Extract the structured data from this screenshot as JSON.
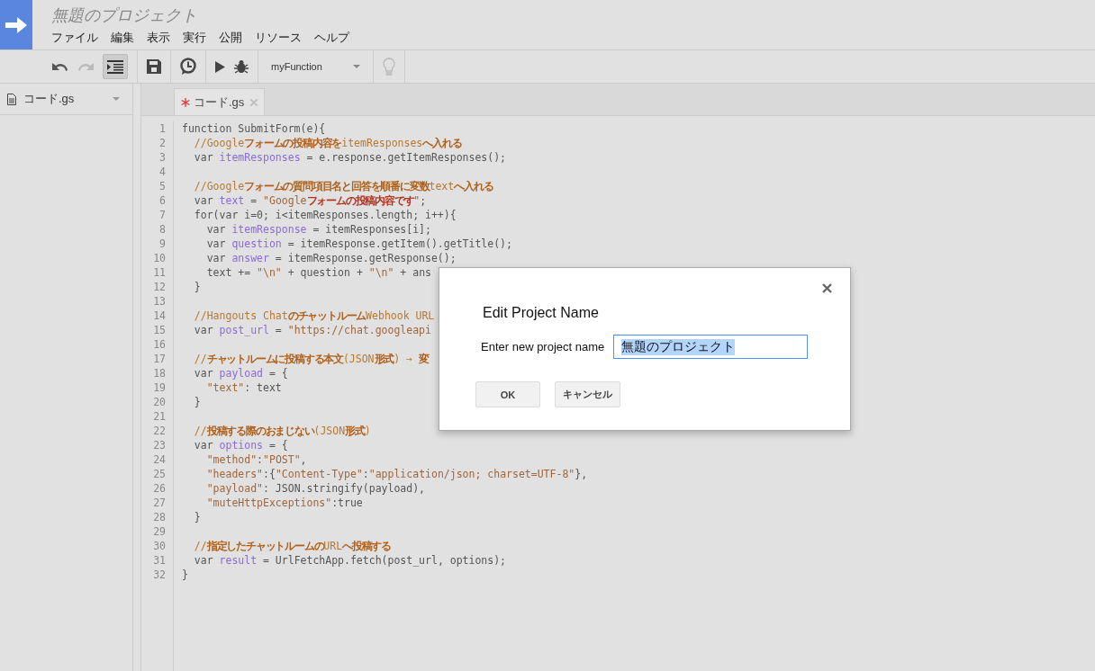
{
  "header": {
    "title": "無題のプロジェクト",
    "menu": [
      "ファイル",
      "編集",
      "表示",
      "実行",
      "公開",
      "リソース",
      "ヘルプ"
    ]
  },
  "toolbar": {
    "undo_disabled": false,
    "redo_disabled": true,
    "indent_on": true,
    "function_select": "myFunction",
    "hint_disabled": true
  },
  "sidebar": {
    "files": [
      {
        "name": "コード.gs"
      }
    ]
  },
  "tabs": [
    {
      "label": "コード.gs",
      "selected": true,
      "modified": true
    }
  ],
  "code": [
    {
      "number": "1",
      "tokens": [
        {
          "text": "function SubmitForm(e){",
          "kind": "plain"
        }
      ]
    },
    {
      "number": "2",
      "tokens": [
        {
          "text": "  //Google",
          "kind": "comment"
        },
        {
          "text": "フォームの投稿内容を",
          "kind": "comment-jp"
        },
        {
          "text": "itemResponses",
          "kind": "comment"
        },
        {
          "text": "へ入れる",
          "kind": "comment-jp"
        }
      ]
    },
    {
      "number": "3",
      "tokens": [
        {
          "text": "  var ",
          "kind": "plain"
        },
        {
          "text": "itemResponses",
          "kind": "def"
        },
        {
          "text": " = e.response.getItemResponses();",
          "kind": "plain"
        }
      ]
    },
    {
      "number": "4"
    },
    {
      "number": "5",
      "tokens": [
        {
          "text": "  //Google",
          "kind": "comment"
        },
        {
          "text": "フォームの質問項目名と回答を順番に変数",
          "kind": "comment-jp"
        },
        {
          "text": "text",
          "kind": "comment"
        },
        {
          "text": "へ入れる",
          "kind": "comment-jp"
        }
      ]
    },
    {
      "number": "6",
      "tokens": [
        {
          "text": "  var ",
          "kind": "plain"
        },
        {
          "text": "text",
          "kind": "def"
        },
        {
          "text": " = ",
          "kind": "plain"
        },
        {
          "text": "\"Google",
          "kind": "string"
        },
        {
          "text": "フォームの投稿内容です",
          "kind": "string-jp"
        },
        {
          "text": "\"",
          "kind": "string"
        },
        {
          "text": ";",
          "kind": "plain"
        }
      ]
    },
    {
      "number": "7",
      "tokens": [
        {
          "text": "  for(var i=0; i<itemResponses.length; i++){",
          "kind": "plain"
        }
      ]
    },
    {
      "number": "8",
      "tokens": [
        {
          "text": "    var ",
          "kind": "plain"
        },
        {
          "text": "itemResponse",
          "kind": "def"
        },
        {
          "text": " = itemResponses[i];",
          "kind": "plain"
        }
      ]
    },
    {
      "number": "9",
      "tokens": [
        {
          "text": "    var ",
          "kind": "plain"
        },
        {
          "text": "question",
          "kind": "def"
        },
        {
          "text": " = itemResponse.getItem().getTitle();",
          "kind": "plain"
        }
      ]
    },
    {
      "number": "10",
      "tokens": [
        {
          "text": "    var ",
          "kind": "plain"
        },
        {
          "text": "answer",
          "kind": "def"
        },
        {
          "text": " = itemResponse.getResponse();",
          "kind": "plain"
        }
      ]
    },
    {
      "number": "11",
      "tokens": [
        {
          "text": "    text += ",
          "kind": "plain"
        },
        {
          "text": "\"\\n\"",
          "kind": "string"
        },
        {
          "text": " + question + ",
          "kind": "plain"
        },
        {
          "text": "\"\\n\"",
          "kind": "string"
        },
        {
          "text": " + ans",
          "kind": "plain"
        }
      ]
    },
    {
      "number": "12",
      "tokens": [
        {
          "text": "  }",
          "kind": "plain"
        }
      ]
    },
    {
      "number": "13"
    },
    {
      "number": "14",
      "tokens": [
        {
          "text": "  //Hangouts Chat",
          "kind": "comment"
        },
        {
          "text": "のチャットルーム",
          "kind": "comment-jp"
        },
        {
          "text": "Webhook URL",
          "kind": "comment"
        }
      ]
    },
    {
      "number": "15",
      "tokens": [
        {
          "text": "  var ",
          "kind": "plain"
        },
        {
          "text": "post_url",
          "kind": "def"
        },
        {
          "text": " = ",
          "kind": "plain"
        },
        {
          "text": "\"https://chat.googleapi",
          "kind": "string"
        }
      ]
    },
    {
      "number": "16"
    },
    {
      "number": "17",
      "tokens": [
        {
          "text": "  //",
          "kind": "comment"
        },
        {
          "text": "チャットルームに投稿する本文",
          "kind": "comment-jp"
        },
        {
          "text": "(JSON",
          "kind": "comment"
        },
        {
          "text": "形式",
          "kind": "comment-jp"
        },
        {
          "text": ") → ",
          "kind": "comment"
        },
        {
          "text": "変",
          "kind": "comment-jp"
        }
      ]
    },
    {
      "number": "18",
      "tokens": [
        {
          "text": "  var ",
          "kind": "plain"
        },
        {
          "text": "payload",
          "kind": "def"
        },
        {
          "text": " = {",
          "kind": "plain"
        }
      ]
    },
    {
      "number": "19",
      "tokens": [
        {
          "text": "    \"text\"",
          "kind": "string"
        },
        {
          "text": ": text",
          "kind": "plain"
        }
      ]
    },
    {
      "number": "20",
      "tokens": [
        {
          "text": "  }",
          "kind": "plain"
        }
      ]
    },
    {
      "number": "21"
    },
    {
      "number": "22",
      "tokens": [
        {
          "text": "  //",
          "kind": "comment"
        },
        {
          "text": "投稿する際のおまじない",
          "kind": "comment-jp"
        },
        {
          "text": "(JSON",
          "kind": "comment"
        },
        {
          "text": "形式",
          "kind": "comment-jp"
        },
        {
          "text": ")",
          "kind": "comment"
        }
      ]
    },
    {
      "number": "23",
      "tokens": [
        {
          "text": "  var ",
          "kind": "plain"
        },
        {
          "text": "options",
          "kind": "def"
        },
        {
          "text": " = {",
          "kind": "plain"
        }
      ]
    },
    {
      "number": "24",
      "tokens": [
        {
          "text": "    \"method\"",
          "kind": "string"
        },
        {
          "text": ":",
          "kind": "plain"
        },
        {
          "text": "\"POST\"",
          "kind": "string"
        },
        {
          "text": ",",
          "kind": "plain"
        }
      ]
    },
    {
      "number": "25",
      "tokens": [
        {
          "text": "    \"headers\"",
          "kind": "string"
        },
        {
          "text": ":{",
          "kind": "plain"
        },
        {
          "text": "\"Content-Type\"",
          "kind": "string"
        },
        {
          "text": ":",
          "kind": "plain"
        },
        {
          "text": "\"application/json; charset=UTF-8\"",
          "kind": "string"
        },
        {
          "text": "},",
          "kind": "plain"
        }
      ]
    },
    {
      "number": "26",
      "tokens": [
        {
          "text": "    \"payload\"",
          "kind": "string"
        },
        {
          "text": ": JSON.stringify(payload),",
          "kind": "plain"
        }
      ]
    },
    {
      "number": "27",
      "tokens": [
        {
          "text": "    \"muteHttpExceptions\"",
          "kind": "string"
        },
        {
          "text": ":true",
          "kind": "plain"
        }
      ]
    },
    {
      "number": "28",
      "tokens": [
        {
          "text": "  }",
          "kind": "plain"
        }
      ]
    },
    {
      "number": "29"
    },
    {
      "number": "30",
      "tokens": [
        {
          "text": "  //",
          "kind": "comment"
        },
        {
          "text": "指定したチャットルームの",
          "kind": "comment-jp"
        },
        {
          "text": "URL",
          "kind": "comment"
        },
        {
          "text": "へ投稿する",
          "kind": "comment-jp"
        }
      ]
    },
    {
      "number": "31",
      "tokens": [
        {
          "text": "  var ",
          "kind": "plain"
        },
        {
          "text": "result",
          "kind": "def"
        },
        {
          "text": " = UrlFetchApp.fetch(post_url, options);",
          "kind": "plain"
        }
      ]
    },
    {
      "number": "32",
      "tokens": [
        {
          "text": "}",
          "kind": "plain"
        }
      ]
    }
  ],
  "dialog": {
    "title": "Edit Project Name",
    "label": "Enter new project name",
    "value": "無題のプロジェクト",
    "value_selected": true,
    "buttons": [
      "OK",
      "キャンセル"
    ]
  }
}
